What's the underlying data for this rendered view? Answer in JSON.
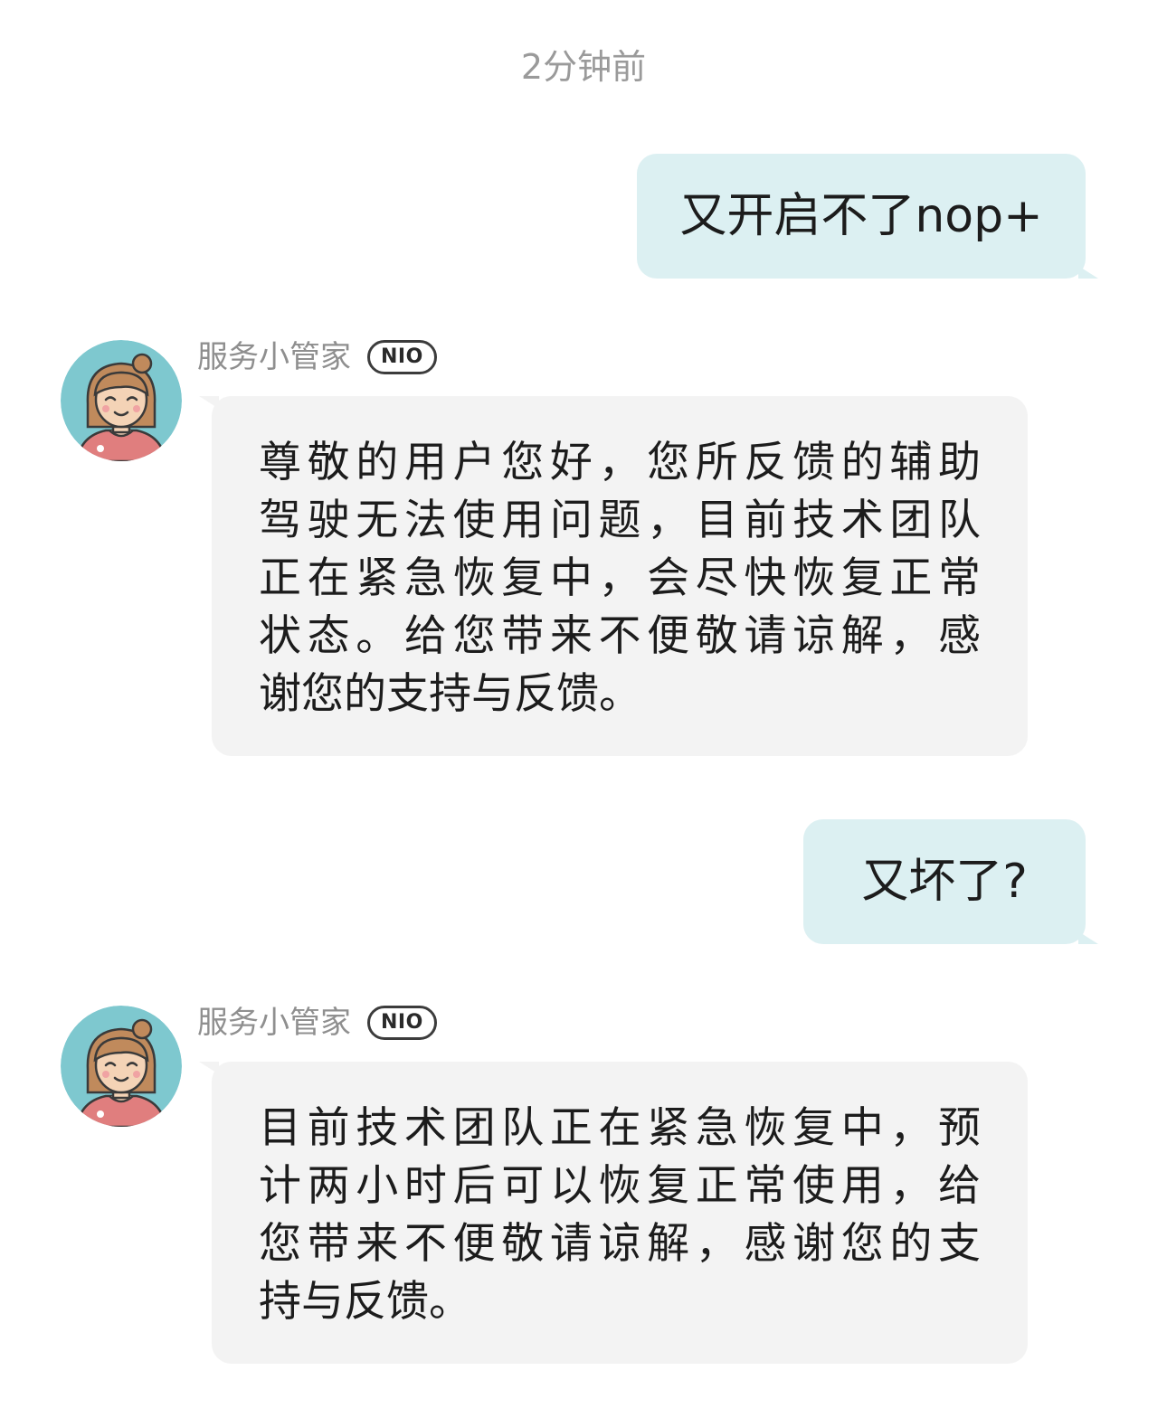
{
  "timestamp": "2分钟前",
  "colors": {
    "user_bubble": "#dcf0f2",
    "bot_bubble": "#f3f3f3",
    "avatar_bg": "#7ec8cf"
  },
  "messages": [
    {
      "role": "user",
      "text": "又开启不了nop+"
    },
    {
      "role": "bot",
      "sender": "服务小管家",
      "badge": "NIO",
      "avatar": "agent-avatar-icon",
      "lines": [
        "尊敬的用户您好，您所反馈的辅助",
        "驾驶无法使用问题，目前技术团队",
        "正在紧急恢复中，会尽快恢复正常",
        "状态。给您带来不便敬请谅解，感",
        "谢您的支持与反馈。"
      ]
    },
    {
      "role": "user",
      "text": "又坏了?"
    },
    {
      "role": "bot",
      "sender": "服务小管家",
      "badge": "NIO",
      "avatar": "agent-avatar-icon",
      "lines": [
        "目前技术团队正在紧急恢复中，预",
        "计两小时后可以恢复正常使用，给",
        "您带来不便敬请谅解，感谢您的支",
        "持与反馈。"
      ]
    }
  ]
}
